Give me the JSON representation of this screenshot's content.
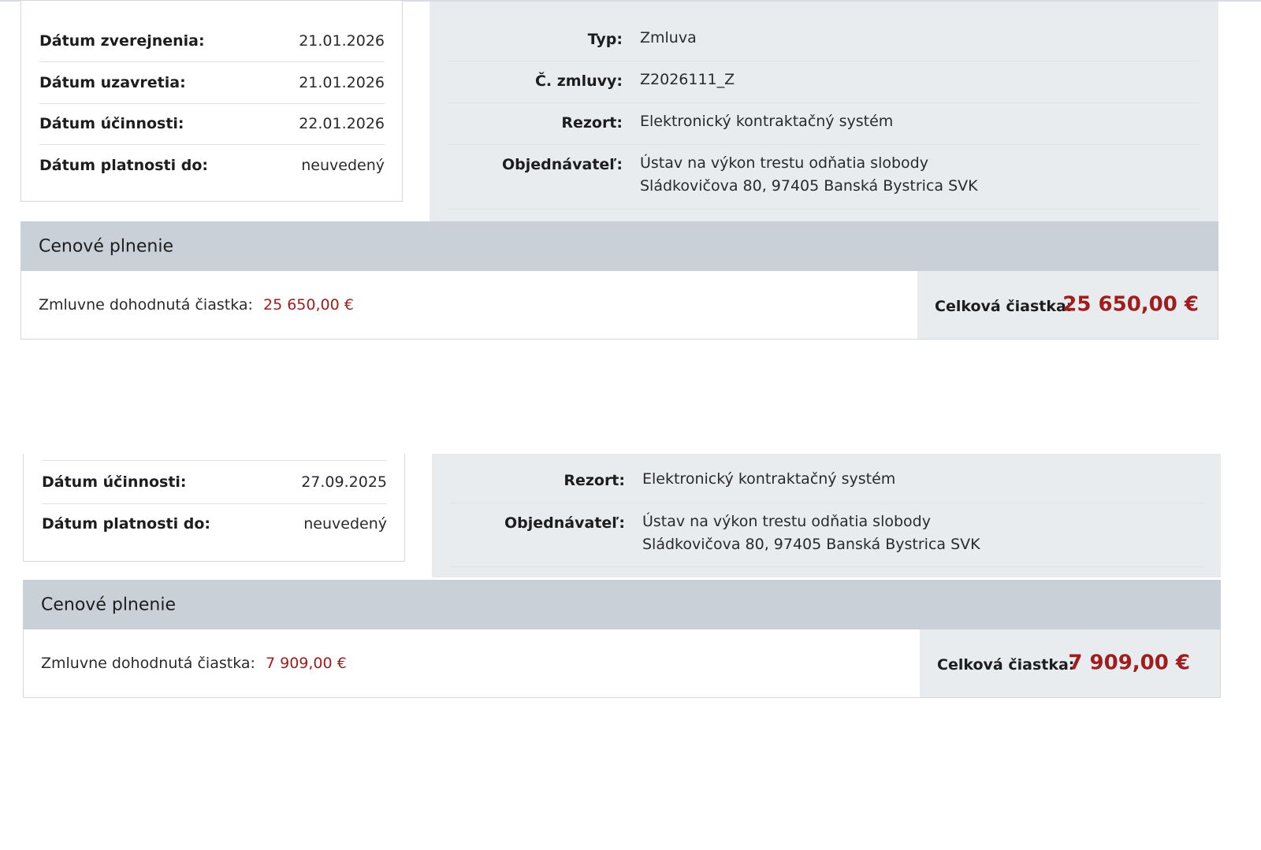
{
  "record1": {
    "dates": [
      {
        "label": "Dátum zverejnenia:",
        "value": "21.01.2026"
      },
      {
        "label": "Dátum uzavretia:",
        "value": "21.01.2026"
      },
      {
        "label": "Dátum účinnosti:",
        "value": "22.01.2026"
      },
      {
        "label": "Dátum platnosti do:",
        "value": "neuvedený"
      }
    ],
    "info": [
      {
        "label": "Typ:",
        "value": "Zmluva"
      },
      {
        "label": "Č. zmluvy:",
        "value": "Z2026111_Z"
      },
      {
        "label": "Rezort:",
        "value": "Elektronický kontraktačný systém"
      },
      {
        "label": "Objednávateľ:",
        "line1": "Ústav na výkon trestu odňatia slobody",
        "line2": "Sládkovičova 80, 97405 Banská Bystrica SVK"
      }
    ],
    "price": {
      "heading": "Cenové plnenie",
      "contract_label": "Zmluvne dohodnutá čiastka:",
      "contract_value": "25 650,00 €",
      "total_label": "Celková čiastka:",
      "total_value": "25 650,00 €"
    }
  },
  "record2": {
    "dates": [
      {
        "label": "Dátum účinnosti:",
        "value": "27.09.2025"
      },
      {
        "label": "Dátum platnosti do:",
        "value": "neuvedený"
      }
    ],
    "info": [
      {
        "label": "Rezort:",
        "value": "Elektronický kontraktačný systém"
      },
      {
        "label": "Objednávateľ:",
        "line1": "Ústav na výkon trestu odňatia slobody",
        "line2": "Sládkovičova 80, 97405 Banská Bystrica SVK"
      }
    ],
    "price": {
      "heading": "Cenové plnenie",
      "contract_label": "Zmluvne dohodnutá čiastka:",
      "contract_value": "7 909,00 €",
      "total_label": "Celková čiastka:",
      "total_value": "7 909,00 €"
    }
  },
  "colors": {
    "accent_red": "#a11d1d",
    "panel_grey": "#e9ecef",
    "header_grey": "#c9d0d8"
  }
}
